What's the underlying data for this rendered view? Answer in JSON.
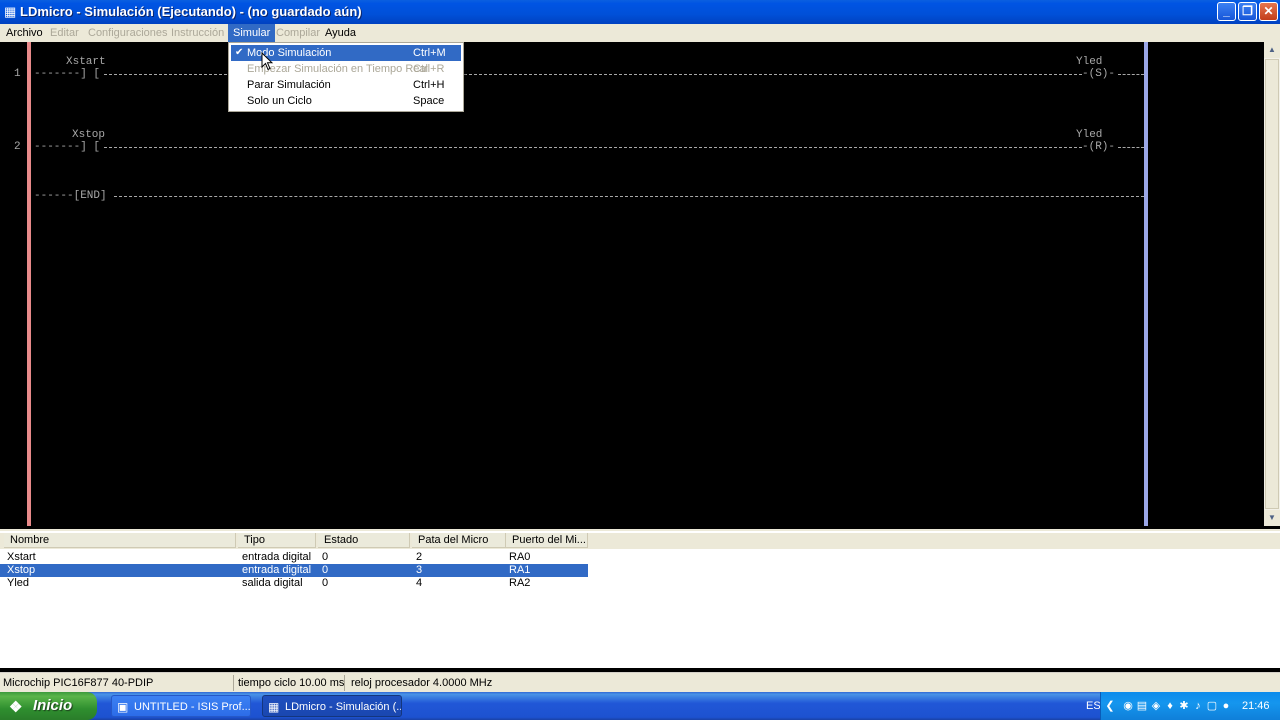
{
  "window": {
    "title": "LDmicro - Simulación (Ejecutando) - (no guardado aún)",
    "controls": {
      "minimize": "_",
      "maximize": "❐",
      "close": "✕"
    }
  },
  "menu": [
    {
      "label": "Archivo",
      "enabled": true
    },
    {
      "label": "Editar",
      "enabled": false
    },
    {
      "label": "Configuraciones",
      "enabled": false
    },
    {
      "label": "Instrucción",
      "enabled": false
    },
    {
      "label": "Simular",
      "enabled": true,
      "active": true
    },
    {
      "label": "Compilar",
      "enabled": false
    },
    {
      "label": "Ayuda",
      "enabled": true
    }
  ],
  "simular_menu": [
    {
      "label": "Modo Simulación",
      "shortcut": "Ctrl+M",
      "checked": true,
      "enabled": true
    },
    {
      "label": "Empezar Simulación en Tiempo Real",
      "shortcut": "Ctrl+R",
      "checked": false,
      "enabled": false
    },
    {
      "label": "Parar Simulación",
      "shortcut": "Ctrl+H",
      "checked": false,
      "enabled": true
    },
    {
      "label": "Solo un Ciclo",
      "shortcut": "Space",
      "checked": false,
      "enabled": true
    }
  ],
  "ladder": {
    "rungs": [
      {
        "number": "1",
        "contact_name": "Xstart",
        "contact_symbol": "-------] [",
        "coil_name": "Yled",
        "coil_symbol": "-(S)-"
      },
      {
        "number": "2",
        "contact_name": "Xstop",
        "contact_symbol": "-------] [",
        "coil_name": "Yled",
        "coil_symbol": "-(R)-"
      }
    ],
    "end_label": "------[END]"
  },
  "io_list": {
    "columns": [
      "Nombre",
      "Tipo",
      "Estado",
      "Pata del Micro",
      "Puerto del Mi..."
    ],
    "rows": [
      {
        "name": "Xstart",
        "type": "entrada digital",
        "state": "0",
        "pin": "2",
        "port": "RA0",
        "selected": false
      },
      {
        "name": "Xstop",
        "type": "entrada digital",
        "state": "0",
        "pin": "3",
        "port": "RA1",
        "selected": true
      },
      {
        "name": "Yled",
        "type": "salida digital",
        "state": "0",
        "pin": "4",
        "port": "RA2",
        "selected": false
      }
    ]
  },
  "status": {
    "micro": "Microchip PIC16F877 40-PDIP",
    "cycle": "tiempo ciclo 10.00 ms",
    "clock": "reloj procesador 4.0000 MHz"
  },
  "taskbar": {
    "start_label": "Inicio",
    "tasks": [
      {
        "label": "UNTITLED - ISIS Prof...",
        "active": false,
        "icon": "isis-icon"
      },
      {
        "label": "LDmicro - Simulación (...",
        "active": true,
        "icon": "ldmicro-icon"
      }
    ],
    "language": "ES",
    "time": "21:46"
  },
  "colors": {
    "selection": "#316ac5",
    "left_rail": "#e88a8a",
    "right_rail": "#9aa6e6",
    "ladder_text": "#a8a8a8"
  }
}
